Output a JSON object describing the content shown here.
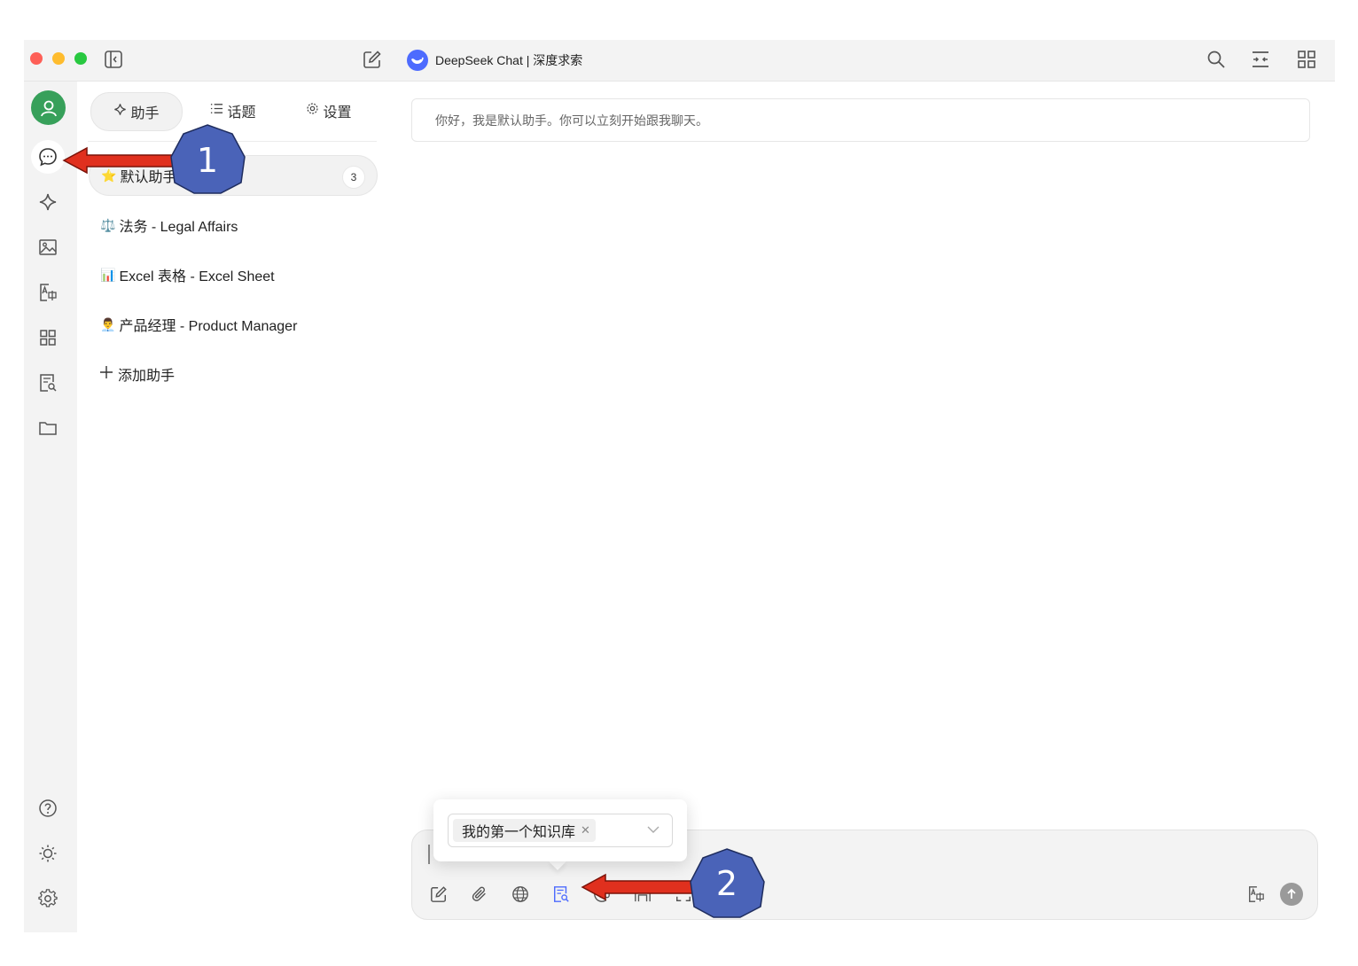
{
  "window": {
    "title": "DeepSeek Chat | 深度求索"
  },
  "left_rail": {
    "items": [
      "chat-icon",
      "sparkle-icon",
      "image-icon",
      "translate-icon",
      "apps-icon",
      "knowledge-base-icon",
      "folder-icon"
    ],
    "bottom_items": [
      "help-icon",
      "theme-sun-icon",
      "settings-gear-icon"
    ]
  },
  "panel": {
    "tabs": [
      {
        "label": "助手",
        "icon": "sparkle-icon"
      },
      {
        "label": "话题",
        "icon": "list-icon"
      },
      {
        "label": "设置",
        "icon": "gear-icon"
      }
    ],
    "assistants": [
      {
        "emoji": "⭐",
        "name": "默认助手",
        "count": "3"
      },
      {
        "emoji": "⚖️",
        "name": "法务 - Legal Affairs"
      },
      {
        "emoji": "📊",
        "name": "Excel 表格 - Excel Sheet"
      },
      {
        "emoji": "👨‍💼",
        "name": "产品经理 - Product Manager"
      }
    ],
    "add_label": "添加助手"
  },
  "chat": {
    "greeting": "你好，我是默认助手。你可以立刻开始跟我聊天。"
  },
  "knowledge_popover": {
    "selected_tag": "我的第一个知识库"
  },
  "annotations": {
    "marker1": "1",
    "marker2": "2"
  },
  "colors": {
    "accent": "#4d6bfe",
    "annotation_fill": "#4a63b8",
    "arrow_red": "#e0301e",
    "avatar_green": "#37a05a"
  }
}
